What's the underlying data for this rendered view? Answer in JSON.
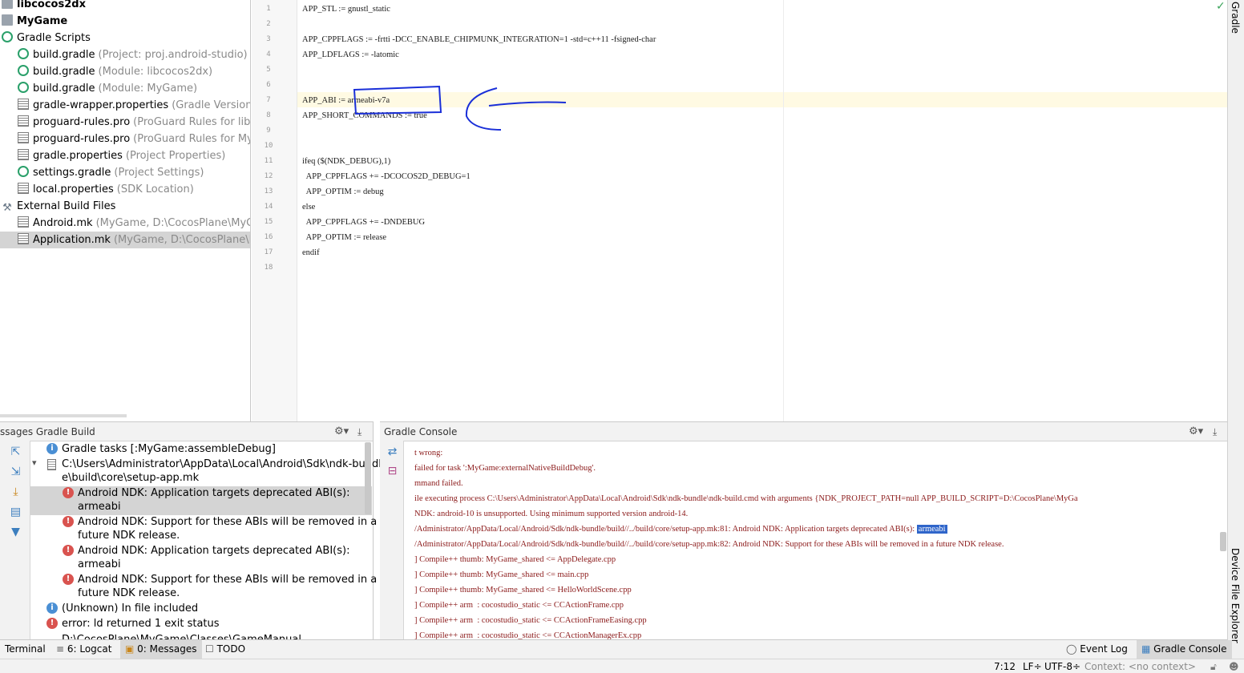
{
  "tree": {
    "items": [
      {
        "label": "libcocos2dx",
        "hint": "",
        "icon": "folder-icon",
        "bold": true
      },
      {
        "label": "MyGame",
        "hint": "",
        "icon": "folder-icon",
        "bold": true
      },
      {
        "label": "Gradle Scripts",
        "hint": "",
        "icon": "gradle-icon"
      },
      {
        "label": "build.gradle",
        "hint": "(Project: proj.android-studio)",
        "icon": "gradle-icon"
      },
      {
        "label": "build.gradle",
        "hint": "(Module: libcocos2dx)",
        "icon": "gradle-icon"
      },
      {
        "label": "build.gradle",
        "hint": "(Module: MyGame)",
        "icon": "gradle-icon"
      },
      {
        "label": "gradle-wrapper.properties",
        "hint": "(Gradle Version)",
        "icon": "properties-file-icon"
      },
      {
        "label": "proguard-rules.pro",
        "hint": "(ProGuard Rules for libcoco",
        "icon": "text-file-icon"
      },
      {
        "label": "proguard-rules.pro",
        "hint": "(ProGuard Rules for MyGa",
        "icon": "text-file-icon"
      },
      {
        "label": "gradle.properties",
        "hint": "(Project Properties)",
        "icon": "properties-file-icon"
      },
      {
        "label": "settings.gradle",
        "hint": "(Project Settings)",
        "icon": "gradle-icon"
      },
      {
        "label": "local.properties",
        "hint": "(SDK Location)",
        "icon": "properties-file-icon"
      },
      {
        "label": "External Build Files",
        "hint": "",
        "icon": "external-build-icon"
      },
      {
        "label": "Android.mk",
        "hint": "(MyGame, D:\\CocosPlane\\MyGame",
        "icon": "text-file-icon"
      },
      {
        "label": "Application.mk",
        "hint": "(MyGame, D:\\CocosPlane\\MyGa",
        "icon": "text-file-icon",
        "selected": true
      }
    ]
  },
  "editor": {
    "lines": [
      "APP_STL := gnustl_static",
      "",
      "APP_CPPFLAGS := -frtti -DCC_ENABLE_CHIPMUNK_INTEGRATION=1 -std=c++11 -fsigned-char",
      "APP_LDFLAGS := -latomic",
      "",
      "",
      "APP_ABI := armeabi-v7a",
      "APP_SHORT_COMMANDS := true",
      "",
      "",
      "ifeq ($(NDK_DEBUG),1)",
      "  APP_CPPFLAGS += -DCOCOS2D_DEBUG=1",
      "  APP_OPTIM := debug",
      "else",
      "  APP_CPPFLAGS += -DNDEBUG",
      "  APP_OPTIM := release",
      "endif",
      ""
    ],
    "current_line": 7
  },
  "messages": {
    "title": "ssages Gradle Build",
    "rows": [
      {
        "type": "info",
        "lines": [
          "Gradle tasks [:MyGame:assembleDebug]"
        ],
        "indent": 0
      },
      {
        "type": "file",
        "lines": [
          "C:\\Users\\Administrator\\AppData\\Local\\Android\\Sdk\\ndk-bundl",
          "e\\build\\core\\setup-app.mk"
        ],
        "indent": 0
      },
      {
        "type": "error",
        "lines": [
          "Android NDK: Application targets deprecated ABI(s):",
          "armeabi"
        ],
        "indent": 1,
        "selected": true
      },
      {
        "type": "error",
        "lines": [
          "Android NDK: Support for these ABIs will be removed in a",
          "future NDK release."
        ],
        "indent": 1
      },
      {
        "type": "error",
        "lines": [
          "Android NDK: Application targets deprecated ABI(s):",
          "armeabi"
        ],
        "indent": 1
      },
      {
        "type": "error",
        "lines": [
          "Android NDK: Support for these ABIs will be removed in a",
          "future NDK release."
        ],
        "indent": 1
      },
      {
        "type": "info",
        "lines": [
          "(Unknown) In file included"
        ],
        "indent": 0
      },
      {
        "type": "error",
        "lines": [
          "error: ld returned 1 exit status"
        ],
        "indent": 0
      }
    ],
    "cut_row": "D:\\CocosPlane\\MyGame\\Classes\\GameManual..."
  },
  "console": {
    "title": "Gradle Console",
    "lines": [
      {
        "text": "t wrong:"
      },
      {
        "text": "failed for task ':MyGame:externalNativeBuildDebug'."
      },
      {
        "text": "mmand failed."
      },
      {
        "text": "ile executing process C:\\Users\\Administrator\\AppData\\Local\\Android\\Sdk\\ndk-bundle\\ndk-build.cmd with arguments {NDK_PROJECT_PATH=null APP_BUILD_SCRIPT=D:\\CocosPlane\\MyGa"
      },
      {
        "text": "NDK: android-10 is unsupported. Using minimum supported version android-14."
      },
      {
        "text": "/Administrator/AppData/Local/Android/Sdk/ndk-bundle/build//../build/core/setup-app.mk:81: Android NDK: Application targets deprecated ABI(s): ",
        "highlight": "armeabi"
      },
      {
        "text": "/Administrator/AppData/Local/Android/Sdk/ndk-bundle/build//../build/core/setup-app.mk:82: Android NDK: Support for these ABIs will be removed in a future NDK release."
      },
      {
        "text": "] Compile++ thumb: MyGame_shared <= AppDelegate.cpp"
      },
      {
        "text": "] Compile++ thumb: MyGame_shared <= main.cpp"
      },
      {
        "text": "] Compile++ thumb: MyGame_shared <= HelloWorldScene.cpp"
      },
      {
        "text": "] Compile++ arm  : cocostudio_static <= CCActionFrame.cpp"
      },
      {
        "text": "] Compile++ arm  : cocostudio_static <= CCActionFrameEasing.cpp"
      },
      {
        "text": "] Compile++ arm  : cocostudio_static <= CCActionManagerEx.cpp"
      }
    ]
  },
  "bottom_tabs": {
    "terminal": "Terminal",
    "logcat": "6: Logcat",
    "messages": "0: Messages",
    "todo": "TODO",
    "event_log": "Event Log",
    "gradle_console": "Gradle Console"
  },
  "right_tabs": {
    "gradle": "Gradle",
    "device_file_explorer": "Device File Explorer"
  },
  "status": {
    "position": "7:12",
    "line_sep": "LF÷",
    "encoding": "UTF-8÷",
    "context": "Context: <no context>"
  }
}
